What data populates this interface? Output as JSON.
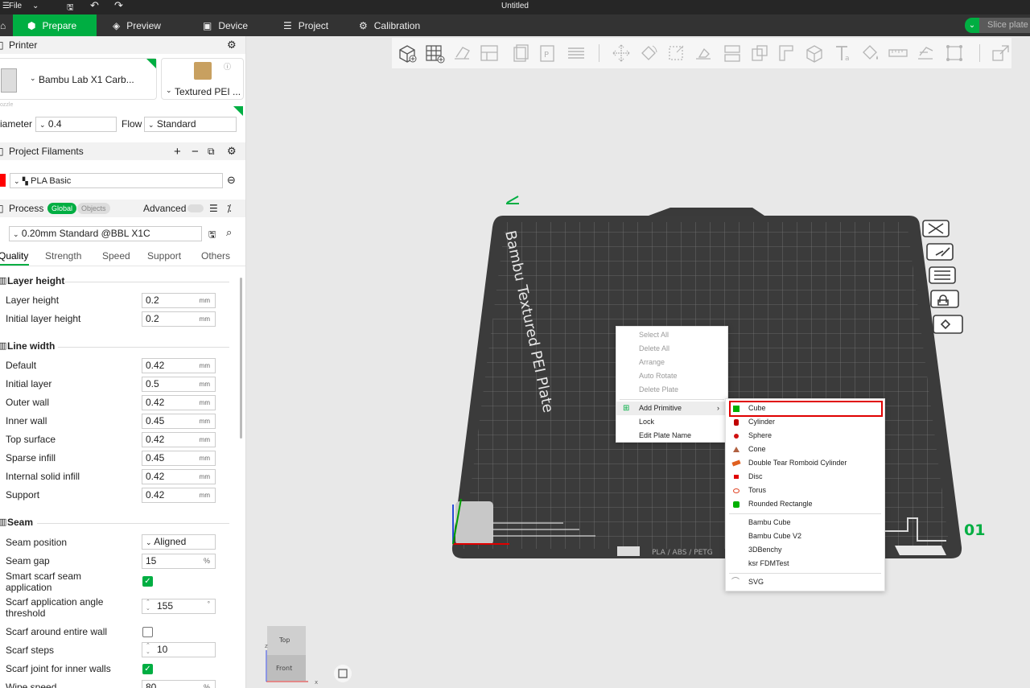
{
  "window": {
    "title": "Untitled",
    "menu_file": "File"
  },
  "nav": {
    "tabs": [
      "Prepare",
      "Preview",
      "Device",
      "Project",
      "Calibration"
    ],
    "slice_label": "Slice plate"
  },
  "printer": {
    "section_title": "Printer",
    "printer_name": "Bambu Lab X1 Carb...",
    "plate_type": "Textured PEI ...",
    "nozzle_label": "ozzle",
    "diameter_label": "iameter",
    "diameter_value": "0.4",
    "flow_label": "Flow",
    "flow_value": "Standard"
  },
  "filaments": {
    "section_title": "Project Filaments",
    "items": [
      {
        "name": "PLA Basic",
        "color": "#ff0000"
      }
    ]
  },
  "process": {
    "section_title": "Process",
    "toggle_global": "Global",
    "toggle_objects": "Objects",
    "advanced_label": "Advanced",
    "preset": "0.20mm Standard @BBL X1C",
    "tabs": [
      "Quality",
      "Strength",
      "Speed",
      "Support",
      "Others"
    ],
    "groups": {
      "layer_height": {
        "title": "Layer height",
        "rows": [
          {
            "label": "Layer height",
            "value": "0.2",
            "unit": "mm"
          },
          {
            "label": "Initial layer height",
            "value": "0.2",
            "unit": "mm"
          }
        ]
      },
      "line_width": {
        "title": "Line width",
        "rows": [
          {
            "label": "Default",
            "value": "0.42",
            "unit": "mm"
          },
          {
            "label": "Initial layer",
            "value": "0.5",
            "unit": "mm"
          },
          {
            "label": "Outer wall",
            "value": "0.42",
            "unit": "mm"
          },
          {
            "label": "Inner wall",
            "value": "0.45",
            "unit": "mm"
          },
          {
            "label": "Top surface",
            "value": "0.42",
            "unit": "mm"
          },
          {
            "label": "Sparse infill",
            "value": "0.45",
            "unit": "mm"
          },
          {
            "label": "Internal solid infill",
            "value": "0.42",
            "unit": "mm"
          },
          {
            "label": "Support",
            "value": "0.42",
            "unit": "mm"
          }
        ]
      },
      "seam": {
        "title": "Seam",
        "seam_position_label": "Seam position",
        "seam_position_value": "Aligned",
        "seam_gap_label": "Seam gap",
        "seam_gap_value": "15",
        "seam_gap_unit": "%",
        "smart_scarf_label_1": "Smart scarf seam",
        "smart_scarf_label_2": "application",
        "scarf_angle_label_1": "Scarf application angle",
        "scarf_angle_label_2": "threshold",
        "scarf_angle_value": "155",
        "scarf_angle_unit": "°",
        "scarf_entire_label": "Scarf around entire wall",
        "scarf_steps_label": "Scarf steps",
        "scarf_steps_value": "10",
        "scarf_inner_label": "Scarf joint for inner walls",
        "wipe_speed_label": "Wipe speed",
        "wipe_speed_value": "80",
        "wipe_speed_unit": "%"
      }
    }
  },
  "viewport": {
    "plate_text": "Bambu Textured PEI Plate",
    "plate_number": "01",
    "plate_bottom_text": "PLA / ABS / PETG",
    "view_cube_top": "Top",
    "view_cube_front": "Front",
    "axis_x": "x",
    "axis_z": "z"
  },
  "context_menu": {
    "items": [
      "Select All",
      "Delete All",
      "Arrange",
      "Auto Rotate",
      "Delete Plate",
      "Add Primitive",
      "Lock",
      "Edit Plate Name"
    ]
  },
  "primitive_menu": {
    "items": [
      {
        "label": "Cube",
        "icon": "green-cube-icon",
        "color": "#00b000"
      },
      {
        "label": "Cylinder",
        "icon": "red-cylinder-icon",
        "color": "#c00000"
      },
      {
        "label": "Sphere",
        "icon": "red-sphere-icon",
        "color": "#d01010"
      },
      {
        "label": "Cone",
        "icon": "cone-icon",
        "color": "#b06040"
      },
      {
        "label": "Double Tear Romboid Cylinder",
        "icon": "romboid-icon",
        "color": "#e06020"
      },
      {
        "label": "Disc",
        "icon": "red-disc-icon",
        "color": "#e00000"
      },
      {
        "label": "Torus",
        "icon": "torus-icon",
        "color": "#e04020"
      },
      {
        "label": "Rounded Rectangle",
        "icon": "green-rounded-rect-icon",
        "color": "#00b000"
      },
      {
        "label": "Bambu Cube",
        "icon": "",
        "color": ""
      },
      {
        "label": "Bambu Cube V2",
        "icon": "",
        "color": ""
      },
      {
        "label": "3DBenchy",
        "icon": "",
        "color": ""
      },
      {
        "label": "ksr FDMTest",
        "icon": "",
        "color": ""
      },
      {
        "label": "SVG",
        "icon": "svg-icon",
        "color": ""
      }
    ]
  },
  "colors": {
    "accent": "#00ae42",
    "highlight_border": "#e00000"
  }
}
